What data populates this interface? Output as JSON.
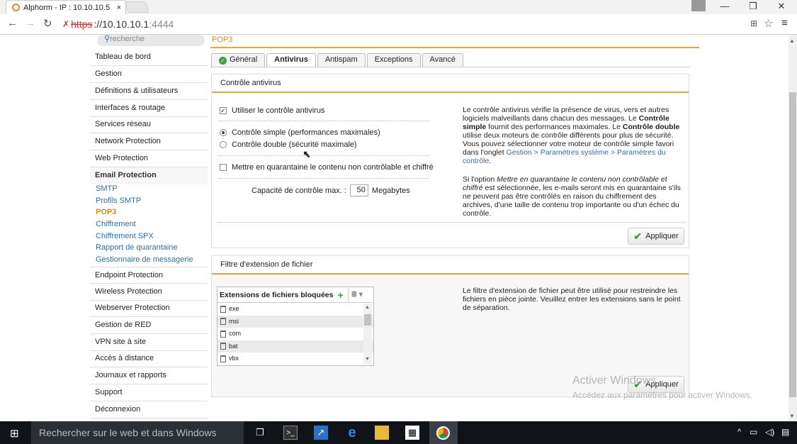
{
  "browser": {
    "tab_title": "Alphorm - IP : 10.10.10.5",
    "tab_close": "×",
    "url_scheme": "https",
    "url_rest": "://10.10.10.1",
    "url_port": ":4444"
  },
  "sidebar": {
    "search_placeholder": "recherche",
    "items": [
      "Tableau de bord",
      "Gestion",
      "Définitions & utilisateurs",
      "Interfaces & routage",
      "Services réseau",
      "Network Protection",
      "Web Protection",
      "Email Protection"
    ],
    "email_sub": [
      "SMTP",
      "Profils SMTP",
      "POP3",
      "Chiffrement",
      "Chiffrement SPX",
      "Rapport de quarantaine",
      "Gestionnaire de messagerie"
    ],
    "items_after": [
      "Endpoint Protection",
      "Wireless Protection",
      "Webserver Protection",
      "Gestion de RED",
      "VPN site à site",
      "Accès à distance",
      "Journaux et rapports",
      "Support",
      "Déconnexion"
    ]
  },
  "breadcrumb": "POP3",
  "tabs": [
    "Général",
    "Antivirus",
    "Antispam",
    "Exceptions",
    "Avancé"
  ],
  "antivirus": {
    "title": "Contrôle antivirus",
    "use_av": "Utiliser le contrôle antivirus",
    "simple": "Contrôle simple (performances maximales)",
    "double": "Contrôle double (sécurité maximale)",
    "quarantine": "Mettre en quarantaine le contenu non contrôlable et chiffré",
    "capacity_label": "Capacité de contrôle max. :",
    "capacity_value": "50",
    "capacity_unit": "Megabytes",
    "help1_a": "Le contrôle antivirus vérifie la présence de virus, vers et autres logiciels malveillants dans chacun des messages. Le ",
    "help1_b": "Contrôle simple",
    "help1_c": " fournit des performances maximales. Le ",
    "help1_d": "Contrôle double",
    "help1_e": " utilise deux moteurs de contrôle différents pour plus de sécurité. Vous pouvez sélectionner votre moteur de contrôle simple favori dans l'onglet ",
    "help1_link": "Gestion > Paramètres système > Paramètres du contrôle",
    "help1_f": ".",
    "help2_a": "Si l'option ",
    "help2_b": "Mettre en quarantaine le contenu non contrôlable et chiffré",
    "help2_c": " est sélectionnée, les e-mails seront mis en quarantaine s'ils ne peuvent pas être contrôlés en raison du chiffrement des archives, d'une taille de contenu trop importante ou d'un échec du contrôle.",
    "apply": "Appliquer"
  },
  "filter": {
    "title": "Filtre d'extension de fichier",
    "list_title": "Extensions de fichiers bloquées",
    "extensions": [
      "exe",
      "msi",
      "com",
      "bat",
      "vbx"
    ],
    "help": "Le filtre d'extension de fichier peut être utilisé pour restreindre les fichiers en pièce jointe. Veuillez entrer les extensions sans le point de séparation.",
    "apply": "Appliquer"
  },
  "watermark": {
    "line1": "Activer Windows",
    "line2": "Accédez aux paramètres pour activer Windows."
  },
  "taskbar": {
    "search": "Rechercher sur le web et dans Windows"
  },
  "colors": {
    "accent": "#e8a33c",
    "link": "#2a6fb0",
    "ok": "#3aa33a"
  }
}
